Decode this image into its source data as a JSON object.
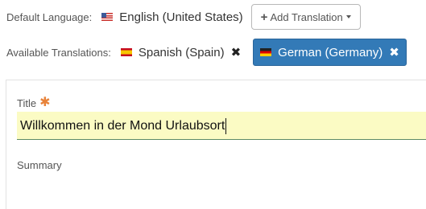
{
  "languages": {
    "default_label": "Default Language:",
    "default_value": "English (United States)",
    "add_translation_label": "Add Translation",
    "available_label": "Available Translations:",
    "translations": [
      {
        "label": "Spanish (Spain)",
        "flag": "spain-flag-icon",
        "active": false
      },
      {
        "label": "German (Germany)",
        "flag": "germany-flag-icon",
        "active": true
      }
    ]
  },
  "form": {
    "title_label": "Title",
    "required_marker": "✱",
    "title_value": "Willkommen in der Mond Urlaubsort",
    "summary_label": "Summary"
  },
  "icons": {
    "plus": "+",
    "remove": "✖"
  },
  "colors": {
    "active_tab": "#337ab7",
    "required": "#e8833a",
    "input_highlight": "#fbfbc4",
    "input_underline": "#5d8b65"
  }
}
